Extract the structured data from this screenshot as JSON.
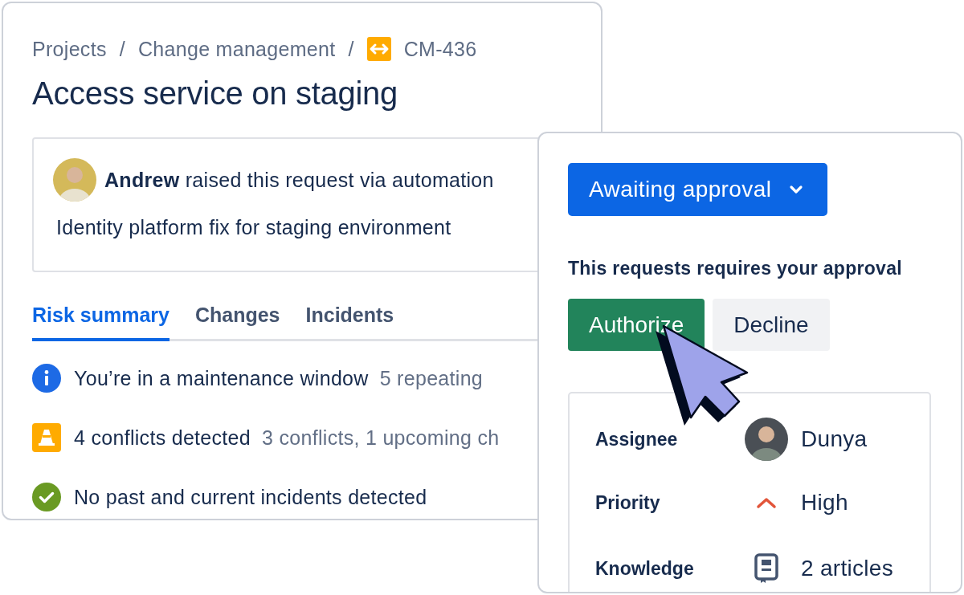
{
  "breadcrumbs": [
    {
      "kind": "link",
      "label": "Projects"
    },
    {
      "kind": "separator",
      "label": "/"
    },
    {
      "kind": "link",
      "label": "Change management"
    },
    {
      "kind": "separator",
      "label": "/"
    },
    {
      "kind": "issue",
      "label": "CM-436"
    }
  ],
  "title": "Access service on staging",
  "request": {
    "message": "**Andrew** raised this request via automation",
    "description": "Identity platform fix for staging environment"
  },
  "tabs": [
    {
      "label": "Risk summary",
      "selected": true
    },
    {
      "label": "Changes",
      "selected": false
    },
    {
      "label": "Incidents",
      "selected": false
    }
  ],
  "risks": [
    {
      "kind": "info",
      "text": "You’re in a maintenance window",
      "detail": "5 repeating"
    },
    {
      "kind": "warning",
      "text": "4 conflicts detected",
      "detail": "3 conflicts, 1 upcoming ch"
    },
    {
      "kind": "success",
      "text": "No past and current incidents detected"
    }
  ],
  "approval_panel": {
    "status": "Awaiting approval",
    "prompt": "This requests requires your approval",
    "buttons": [
      {
        "kind": "primary",
        "label": "Authorize"
      },
      {
        "kind": "secondary",
        "label": "Decline"
      }
    ],
    "fields": [
      {
        "kind": "user",
        "label": "Assignee",
        "value": "Dunya"
      },
      {
        "kind": "priority",
        "label": "Priority",
        "value": "High"
      },
      {
        "kind": "articles",
        "label": "Knowledge",
        "value": "2 articles"
      }
    ]
  }
}
